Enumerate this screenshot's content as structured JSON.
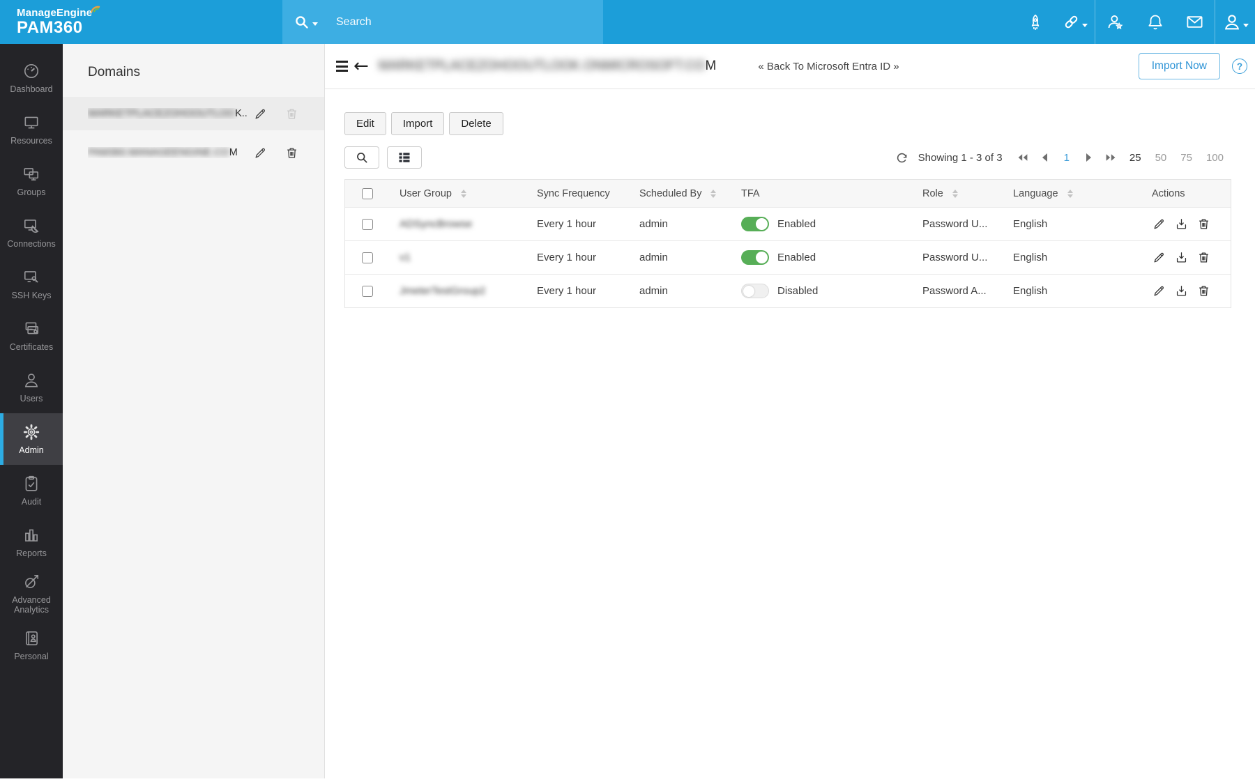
{
  "brand": {
    "name": "ManageEngine",
    "product": "PAM360"
  },
  "topbar": {
    "search_placeholder": "Search",
    "icon_names": [
      "search-icon",
      "rocket-icon",
      "link-icon",
      "user-star-icon",
      "bell-icon",
      "mail-icon",
      "account-icon"
    ]
  },
  "sidebar": {
    "items": [
      {
        "label": "Dashboard",
        "icon": "gauge-icon",
        "active": false
      },
      {
        "label": "Resources",
        "icon": "monitor-icon",
        "active": false
      },
      {
        "label": "Groups",
        "icon": "monitors-icon",
        "active": false
      },
      {
        "label": "Connections",
        "icon": "remote-connection-icon",
        "active": false
      },
      {
        "label": "SSH Keys",
        "icon": "ssh-key-icon",
        "active": false
      },
      {
        "label": "Certificates",
        "icon": "certificate-icon",
        "active": false
      },
      {
        "label": "Users",
        "icon": "person-icon",
        "active": false
      },
      {
        "label": "Admin",
        "icon": "gear-icon",
        "active": true
      },
      {
        "label": "Audit",
        "icon": "clipboard-check-icon",
        "active": false
      },
      {
        "label": "Reports",
        "icon": "bar-chart-icon",
        "active": false
      },
      {
        "label": "Advanced Analytics",
        "icon": "analytics-icon",
        "active": false
      },
      {
        "label": "Personal",
        "icon": "address-book-icon",
        "active": false
      }
    ]
  },
  "domains_panel": {
    "title": "Domains",
    "items": [
      {
        "name": "MARKETPLACEZOHOOUTLOO",
        "suffix": "K....",
        "blurred": true,
        "selected": true,
        "delete_disabled": true
      },
      {
        "name": "PAM360.MANAGEENGINE.CO",
        "suffix": "M",
        "blurred": true,
        "selected": false,
        "delete_disabled": false
      }
    ]
  },
  "page_header": {
    "title": "MARKETPLACEZOHOOUTLOOK.ONMICROSOFT.CO",
    "title_suffix": "M",
    "back_link": "« Back To Microsoft Entra ID »",
    "import_now_label": "Import Now"
  },
  "toolbar": {
    "edit_label": "Edit",
    "import_label": "Import",
    "delete_label": "Delete"
  },
  "pagination": {
    "showing_text": "Showing 1 - 3 of 3",
    "current_page": "1",
    "page_sizes": [
      "25",
      "50",
      "75",
      "100"
    ],
    "active_size": "25"
  },
  "table": {
    "columns": [
      "User Group",
      "Sync Frequency",
      "Scheduled By",
      "TFA",
      "Role",
      "Language",
      "Actions"
    ],
    "rows": [
      {
        "user_group": "ADSyncBrowse",
        "user_group_blurred": true,
        "sync_frequency": "Every 1 hour",
        "scheduled_by": "admin",
        "tfa": "Enabled",
        "role": "Password U...",
        "language": "English"
      },
      {
        "user_group": "v1",
        "user_group_blurred": true,
        "sync_frequency": "Every 1 hour",
        "scheduled_by": "admin",
        "tfa": "Enabled",
        "role": "Password U...",
        "language": "English"
      },
      {
        "user_group": "JmeterTestGroup2",
        "user_group_blurred": true,
        "sync_frequency": "Every 1 hour",
        "scheduled_by": "admin",
        "tfa": "Disabled",
        "role": "Password A...",
        "language": "English"
      }
    ]
  },
  "colors": {
    "topbar": "#1c9ed9",
    "topbar_search": "#3daee3",
    "accent": "#2dace3",
    "toggle_on": "#57ae57",
    "page_link": "#3a9bd8"
  }
}
